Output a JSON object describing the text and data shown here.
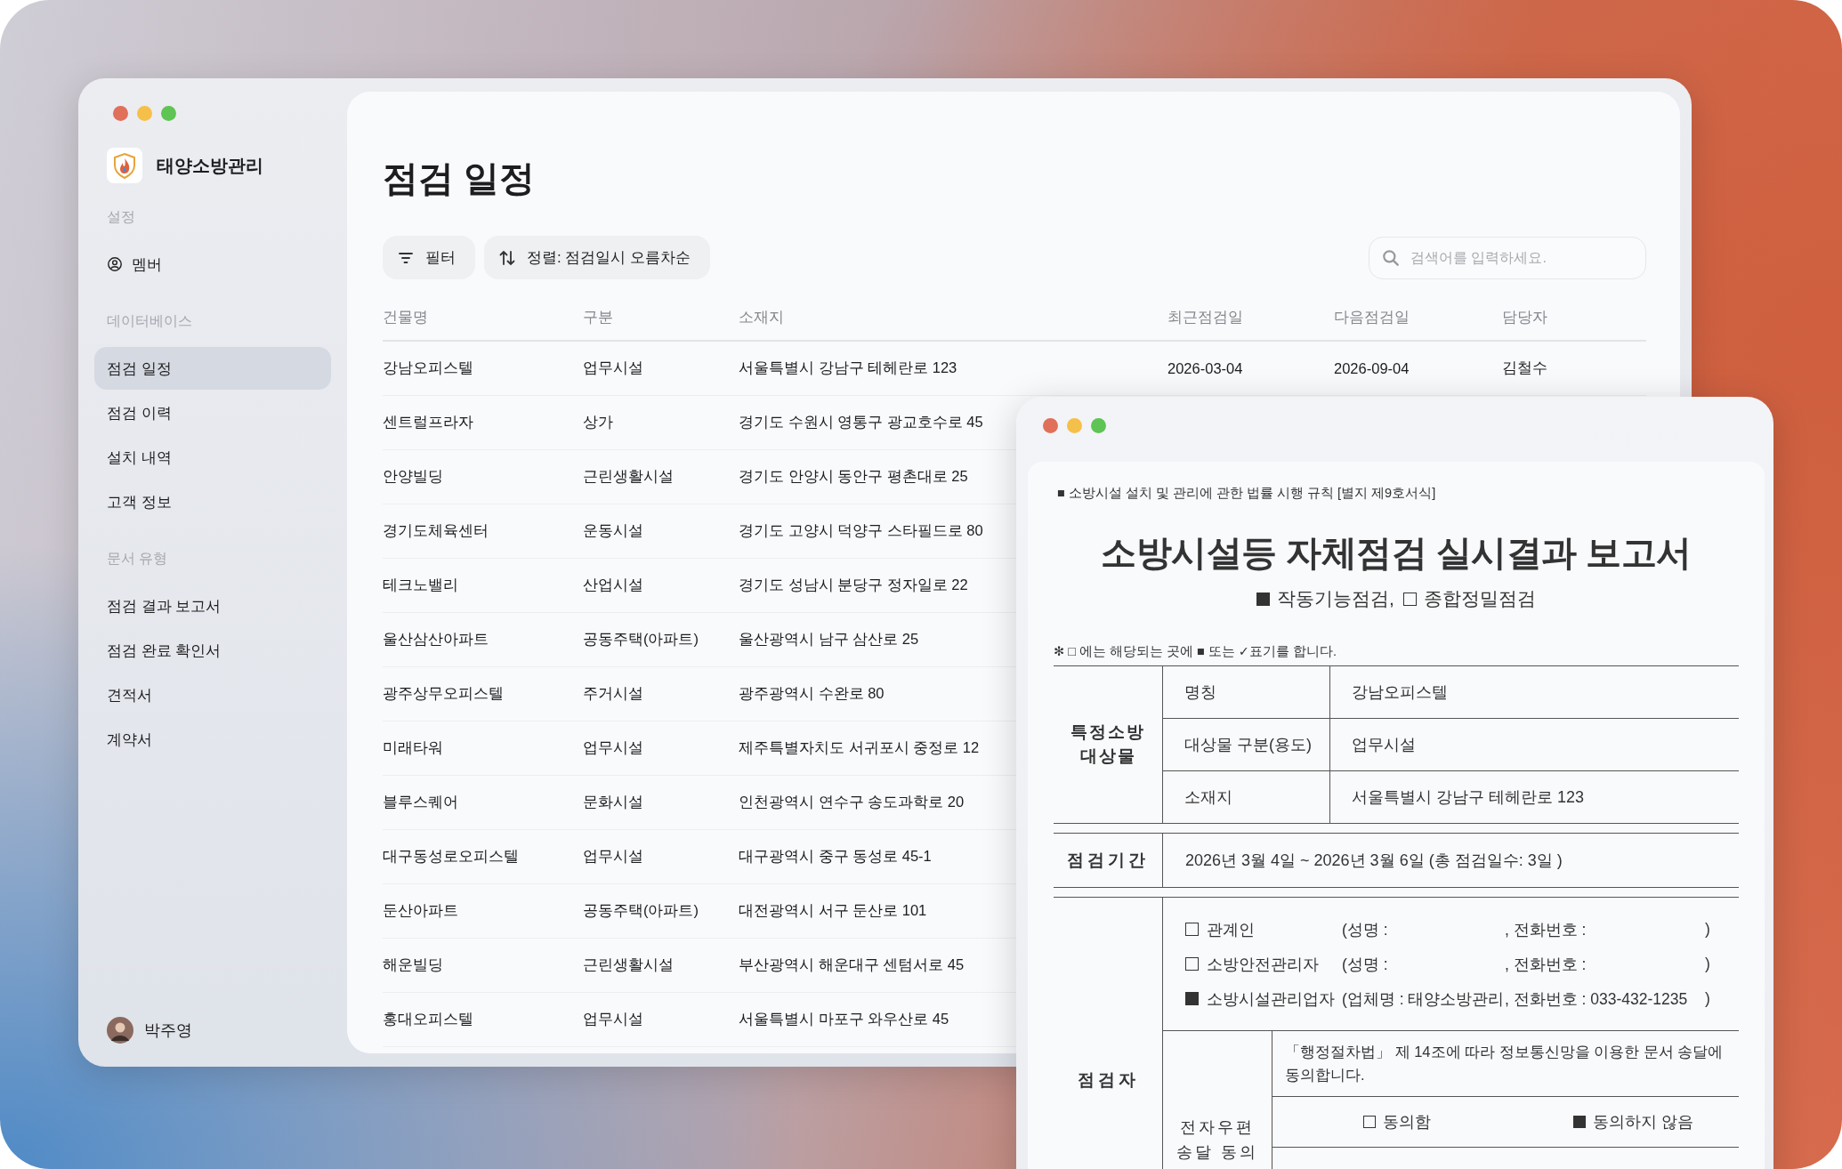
{
  "app_window": {
    "brand": "태양소방관리",
    "sidebar": [
      {
        "heading": "설정",
        "items": [
          {
            "label": "멤버",
            "kind": "member",
            "selected": false
          }
        ]
      },
      {
        "heading": "데이터베이스",
        "items": [
          {
            "label": "점검 일정",
            "kind": "page",
            "selected": true
          },
          {
            "label": "점검 이력",
            "kind": "page",
            "selected": false
          },
          {
            "label": "설치 내역",
            "kind": "page",
            "selected": false
          },
          {
            "label": "고객 정보",
            "kind": "page",
            "selected": false
          }
        ]
      },
      {
        "heading": "문서 유형",
        "items": [
          {
            "label": "점검 결과 보고서",
            "kind": "page",
            "selected": false
          },
          {
            "label": "점검 완료 확인서",
            "kind": "page",
            "selected": false
          },
          {
            "label": "견적서",
            "kind": "page",
            "selected": false
          },
          {
            "label": "계약서",
            "kind": "page",
            "selected": false
          }
        ]
      }
    ],
    "user": {
      "name": "박주영"
    },
    "page": {
      "title": "점검 일정",
      "toolbar": [
        {
          "kind": "filter",
          "label": "필터"
        },
        {
          "kind": "sort",
          "label": "정렬: 점검일시 오름차순"
        }
      ],
      "search": {
        "placeholder": "검색어를 입력하세요."
      },
      "table": {
        "columns": [
          "건물명",
          "구분",
          "소재지",
          "최근점검일",
          "다음점검일",
          "담당자"
        ],
        "rows": [
          {
            "cells": [
              "강남오피스텔",
              "업무시설",
              "서울특별시 강남구 테헤란로 123",
              "2026-03-04",
              "2026-09-04",
              "김철수"
            ]
          },
          {
            "cells": [
              "센트럴프라자",
              "상가",
              "경기도 수원시 영통구 광교호수로 45"
            ]
          },
          {
            "cells": [
              "안양빌딩",
              "근린생활시설",
              "경기도 안양시 동안구 평촌대로 25"
            ]
          },
          {
            "cells": [
              "경기도체육센터",
              "운동시설",
              "경기도 고양시 덕양구 스타필드로 80"
            ]
          },
          {
            "cells": [
              "테크노밸리",
              "산업시설",
              "경기도 성남시 분당구 정자일로 22"
            ]
          },
          {
            "cells": [
              "울산삼산아파트",
              "공동주택(아파트)",
              "울산광역시 남구 삼산로 25"
            ]
          },
          {
            "cells": [
              "광주상무오피스텔",
              "주거시설",
              "광주광역시 수완로 80"
            ]
          },
          {
            "cells": [
              "미래타워",
              "업무시설",
              "제주특별자치도 서귀포시 중정로 12"
            ]
          },
          {
            "cells": [
              "블루스퀘어",
              "문화시설",
              "인천광역시 연수구 송도과학로 20"
            ]
          },
          {
            "cells": [
              "대구동성로오피스텔",
              "업무시설",
              "대구광역시 중구 동성로 45-1"
            ]
          },
          {
            "cells": [
              "둔산아파트",
              "공동주택(아파트)",
              "대전광역시 서구 둔산로 101"
            ]
          },
          {
            "cells": [
              "해운빌딩",
              "근린생활시설",
              "부산광역시 해운대구 센텀서로 45"
            ]
          },
          {
            "cells": [
              "홍대오피스텔",
              "업무시설",
              "서울특별시 마포구 와우산로 45"
            ]
          }
        ]
      }
    }
  },
  "document_window": {
    "form_reference": "■ 소방시설 설치 및 관리에 관한 법률 시행 규칙 [별지 제9호서식]",
    "title": "소방시설등 자체점검 실시결과 보고서",
    "inspection_types": [
      {
        "label": "작동기능점검,",
        "checked": true
      },
      {
        "label": "종합정밀점검",
        "checked": false
      }
    ],
    "note": "✻ □ 에는 해당되는 곳에 ■ 또는 ✓표기를 합니다.",
    "target": {
      "label": "특정소방 대상물",
      "fields": [
        {
          "label": "명칭",
          "value": "강남오피스텔"
        },
        {
          "label": "대상물 구분(용도)",
          "value": "업무시설"
        },
        {
          "label": "소재지",
          "value": "서울특별시 강남구 테헤란로 123"
        }
      ]
    },
    "period": {
      "label": "점검기간",
      "value": "2026년 3월 4일 ~ 2026년 3월 6일 (총 점검일수: 3일 )"
    },
    "inspector": {
      "label": "점검자",
      "people": [
        {
          "role": "관계인",
          "checked": false,
          "name": "(성명 :",
          "phone": ", 전화번호 :",
          "end": ")"
        },
        {
          "role": "소방안전관리자",
          "checked": false,
          "name": "(성명 :",
          "phone": ", 전화번호 :",
          "end": ")"
        },
        {
          "role": "소방시설관리업자",
          "checked": true,
          "name": "(업체명 : 태양소방관리",
          "phone": ", 전화번호 : 033-432-1235",
          "end": ")"
        }
      ],
      "consent": {
        "label": "전자우편 송달 동의",
        "text": "「행정절차법」 제 14조에 따라 정보통신망을 이용한 문서 송달에 동의합니다.",
        "options": [
          {
            "label": "동의함",
            "checked": false
          },
          {
            "label": "동의하지 않음",
            "checked": true
          }
        ]
      }
    }
  }
}
